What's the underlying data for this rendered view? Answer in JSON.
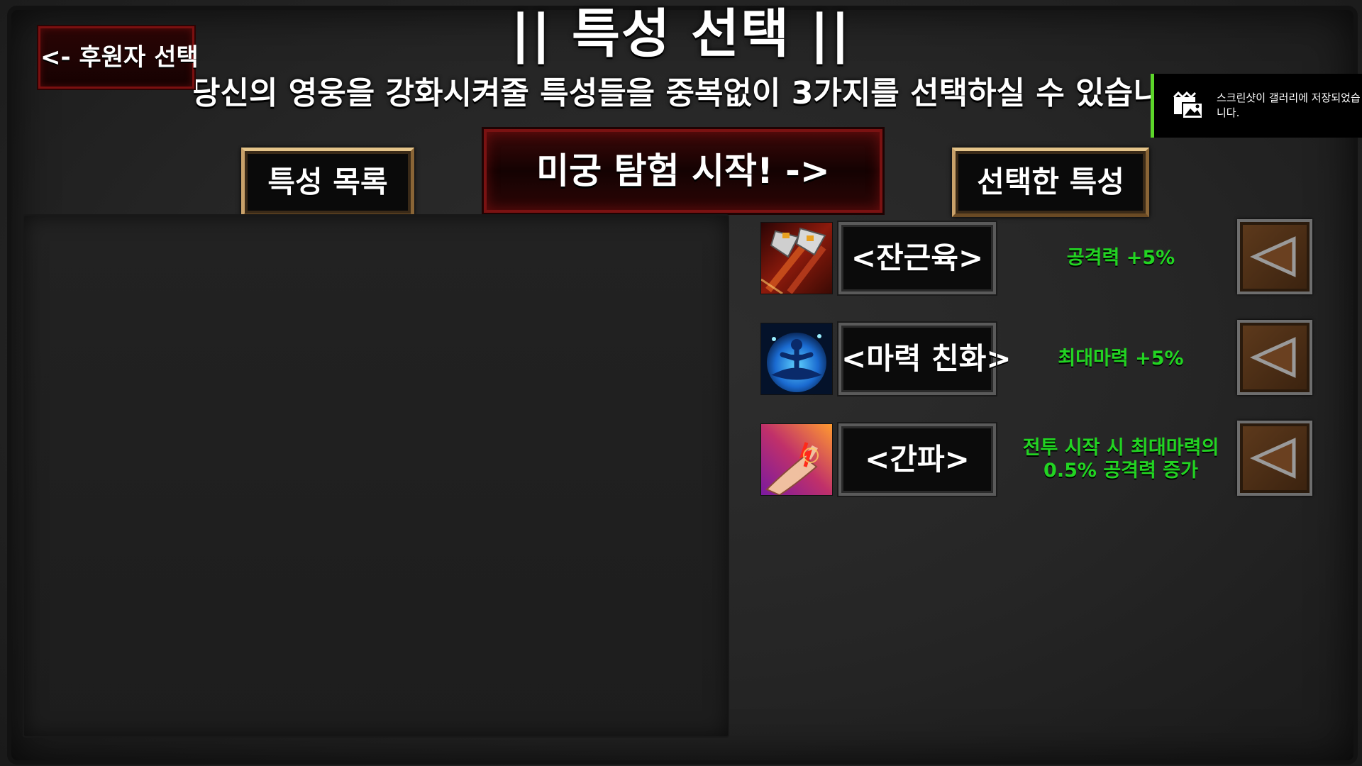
{
  "header": {
    "title": "|| 특성 선택 ||",
    "subtitle": "당신의 영웅을 강화시켜줄 특성들을 중복없이 3가지를 선택하실 수 있습니다"
  },
  "back_button": {
    "label": "<- 후원자 선택"
  },
  "trait_list": {
    "label": "특성 목록"
  },
  "start_button": {
    "label": "미궁 탐험 시작! ->"
  },
  "selected": {
    "label": "선택한 특성",
    "items": [
      {
        "name": "<잔근육>",
        "description": "공격력 +5%",
        "icon": "axe-icon"
      },
      {
        "name": "<마력 친화>",
        "description": "최대마력 +5%",
        "icon": "meditation-icon"
      },
      {
        "name": "<간파>",
        "description": "전투 시작 시 최대마력의 0.5% 공격력 증가",
        "icon": "wrist-icon"
      }
    ]
  },
  "toast": {
    "message": "스크린샷이 갤러리에 저장되었습니다.",
    "icon": "screenshot-gallery-icon",
    "accent_color": "#5cd62a"
  },
  "colors": {
    "description_text": "#22d422",
    "start_button_border": "#7a1212",
    "label_border_gold": "#caa26a"
  }
}
